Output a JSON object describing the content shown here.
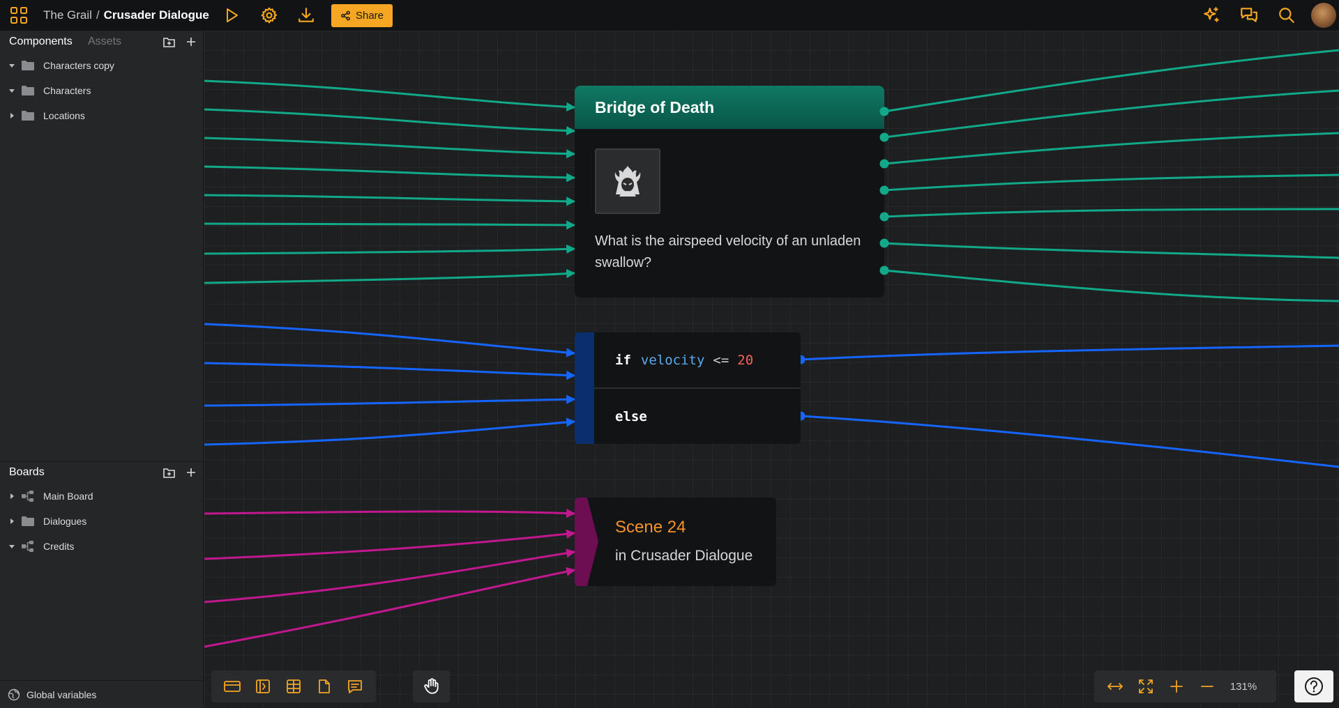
{
  "breadcrumb": {
    "project": "The Grail",
    "separator": "/",
    "current": "Crusader Dialogue"
  },
  "topbar": {
    "share_label": "Share",
    "accent": "#f5a623",
    "left_icons": [
      "apps-grid-icon",
      "play-icon",
      "settings-icon",
      "download-icon"
    ],
    "right_icons": [
      "ai-sparkle-icon",
      "comments-icon",
      "search-icon",
      "user-avatar"
    ]
  },
  "sidebar": {
    "components_tab": "Components",
    "assets_tab": "Assets",
    "components": [
      {
        "label": "Characters copy",
        "expanded": true,
        "type": "folder"
      },
      {
        "label": "Characters",
        "expanded": true,
        "type": "folder"
      },
      {
        "label": "Locations",
        "expanded": false,
        "type": "folder"
      }
    ],
    "boards_title": "Boards",
    "boards": [
      {
        "label": "Main Board",
        "expanded": false,
        "type": "board"
      },
      {
        "label": "Dialogues",
        "expanded": false,
        "type": "folder"
      },
      {
        "label": "Credits",
        "expanded": true,
        "type": "board"
      }
    ],
    "global_variables": "Global variables"
  },
  "nodes": {
    "dialogue": {
      "title": "Bridge of Death",
      "text": "What is the airspeed velocity of an unladen swallow?",
      "color": "#0f7a64"
    },
    "condition": {
      "if_keyword": "if",
      "variable": "velocity",
      "operator": "<=",
      "value": "20",
      "else_keyword": "else",
      "color": "#1565ff"
    },
    "jump": {
      "title": "Scene 24",
      "subtitle": "in Crusader Dialogue",
      "color": "#c2188f"
    }
  },
  "bottom_toolbar": {
    "tools": [
      "dialogue-node-icon",
      "condition-node-icon",
      "table-node-icon",
      "note-node-icon",
      "comment-node-icon"
    ],
    "pan_tool": "hand-icon",
    "zoom_controls": [
      "fit-width-icon",
      "fit-screen-icon",
      "zoom-in-icon",
      "zoom-out-icon"
    ],
    "zoom_level": "131%",
    "help": "help-icon"
  }
}
